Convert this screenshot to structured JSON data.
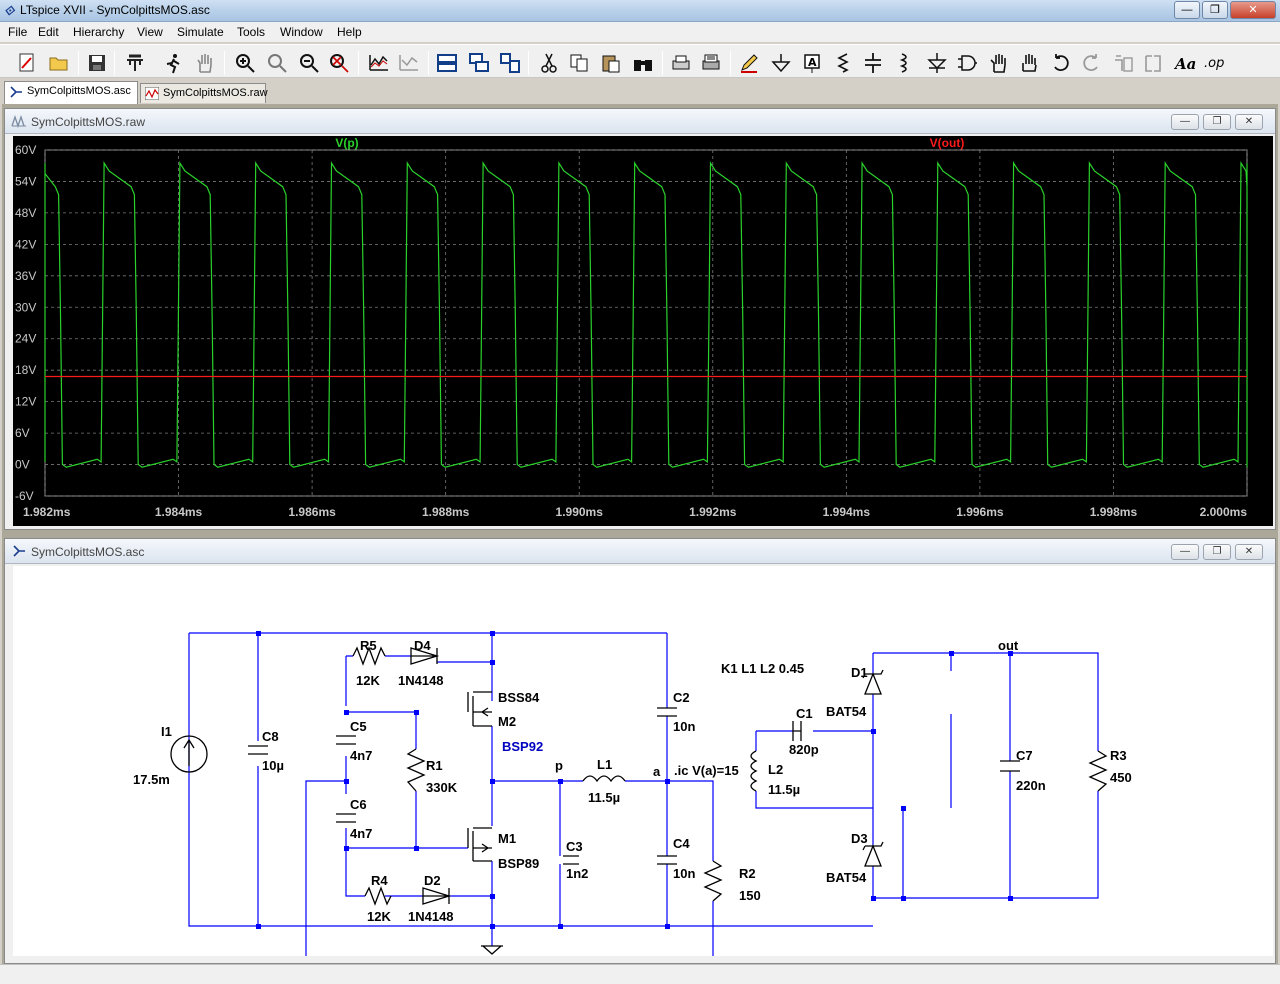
{
  "app": {
    "title": "LTspice XVII - SymColpittsMOS.asc",
    "window_buttons": [
      "—",
      "❐",
      "✕"
    ]
  },
  "menu": [
    {
      "label": "File"
    },
    {
      "label": "Edit"
    },
    {
      "label": "Hierarchy"
    },
    {
      "label": "View"
    },
    {
      "label": "Simulate"
    },
    {
      "label": "Tools"
    },
    {
      "label": "Window"
    },
    {
      "label": "Help"
    }
  ],
  "tabs": [
    {
      "label": "SymColpittsMOS.asc",
      "icon": "schematic-icon",
      "active": true
    },
    {
      "label": "SymColpittsMOS.raw",
      "icon": "waveform-icon",
      "active": false
    }
  ],
  "waveform_window": {
    "title": "SymColpittsMOS.raw",
    "buttons": [
      "—",
      "❐",
      "✕"
    ]
  },
  "schematic_window": {
    "title": "SymColpittsMOS.asc",
    "buttons": [
      "—",
      "❐",
      "✕"
    ]
  },
  "colors": {
    "plot_bg": "#000000",
    "trace_vp": "#2bd12b",
    "trace_vout": "#ff1a1a",
    "grid": "#7a7a7a",
    "axis_text": "#c8c8c8",
    "wire": "#0000ff",
    "component": "#000000",
    "net_label": "#000000",
    "model_label": "#0000c0"
  },
  "chart_data": {
    "type": "line",
    "title": "",
    "xlabel": "",
    "ylabel": "",
    "x_ticks": [
      "1.982ms",
      "1.984ms",
      "1.986ms",
      "1.988ms",
      "1.990ms",
      "1.992ms",
      "1.994ms",
      "1.996ms",
      "1.998ms",
      "2.000ms"
    ],
    "y_ticks": [
      "60V",
      "54V",
      "48V",
      "42V",
      "36V",
      "30V",
      "24V",
      "18V",
      "12V",
      "6V",
      "0V",
      "-6V"
    ],
    "xlim": [
      1.982,
      2.0
    ],
    "ylim": [
      -6,
      60
    ],
    "x_unit": "ms",
    "y_unit": "V",
    "grid": true,
    "legend": "top",
    "series": [
      {
        "name": "V(p)",
        "color": "#2bd12b",
        "shape": "square-wave",
        "period_ms": 0.001135,
        "first_rise_ms": 1.98284,
        "high": 57.5,
        "low": -0.5,
        "duty": 0.44
      },
      {
        "name": "V(out)",
        "color": "#ff1a1a",
        "shape": "constant",
        "value": 16.8
      }
    ]
  },
  "schematic": {
    "directive_coupling": "K1 L1 L2 0.45",
    "directive_ic": ".ic V(a)=15",
    "net_labels": [
      {
        "id": "p",
        "label": "p"
      },
      {
        "id": "a",
        "label": "a"
      },
      {
        "id": "out",
        "label": "out"
      }
    ],
    "components": [
      {
        "ref": "I1",
        "value": "17.5m"
      },
      {
        "ref": "C8",
        "value": "10µ"
      },
      {
        "ref": "R5",
        "value": "12K"
      },
      {
        "ref": "D4",
        "value": "1N4148"
      },
      {
        "ref": "C5",
        "value": "4n7"
      },
      {
        "ref": "C6",
        "value": "4n7"
      },
      {
        "ref": "R1",
        "value": "330K"
      },
      {
        "ref": "R4",
        "value": "12K"
      },
      {
        "ref": "D2",
        "value": "1N4148"
      },
      {
        "ref": "M2",
        "value": "BSS84",
        "model": "BSP92"
      },
      {
        "ref": "M1",
        "value": "BSP89"
      },
      {
        "ref": "C2",
        "value": "10n"
      },
      {
        "ref": "C3",
        "value": "1n2"
      },
      {
        "ref": "L1",
        "value": "11.5µ"
      },
      {
        "ref": "C4",
        "value": "10n"
      },
      {
        "ref": "R2",
        "value": "150"
      },
      {
        "ref": "C1",
        "value": "820p"
      },
      {
        "ref": "L2",
        "value": "11.5µ"
      },
      {
        "ref": "D1",
        "value": "BAT54"
      },
      {
        "ref": "D3",
        "value": "BAT54"
      },
      {
        "ref": "C7",
        "value": "220n"
      },
      {
        "ref": "R3",
        "value": "450"
      }
    ]
  }
}
